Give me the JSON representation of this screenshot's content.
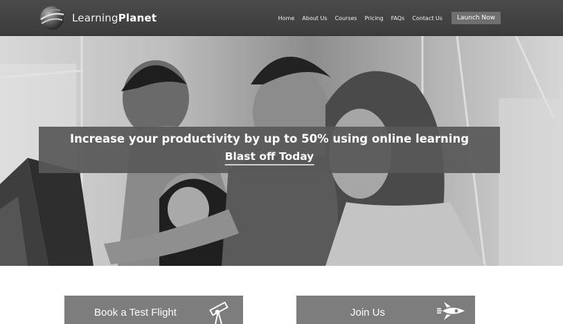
{
  "brand": {
    "name_regular": "Learning",
    "name_bold": "Planet"
  },
  "nav": {
    "links": [
      "Home",
      "About Us",
      "Courses",
      "Pricing",
      "FAQs",
      "Contact Us"
    ],
    "cta": "Launch Now"
  },
  "hero": {
    "headline": "Increase your productivity by up to 50% using online learning",
    "cta": "Blast off Today"
  },
  "cards": {
    "test_flight": "Book a Test Flight",
    "join": "Join Us"
  },
  "icons": {
    "logo": "globe-logo-icon",
    "test_flight": "telescope-icon",
    "join": "rocket-icon"
  },
  "colors": {
    "navbar": "#444444",
    "nav_cta": "#6f6f6f",
    "banner": "#585858",
    "card": "#7d7d7d"
  }
}
